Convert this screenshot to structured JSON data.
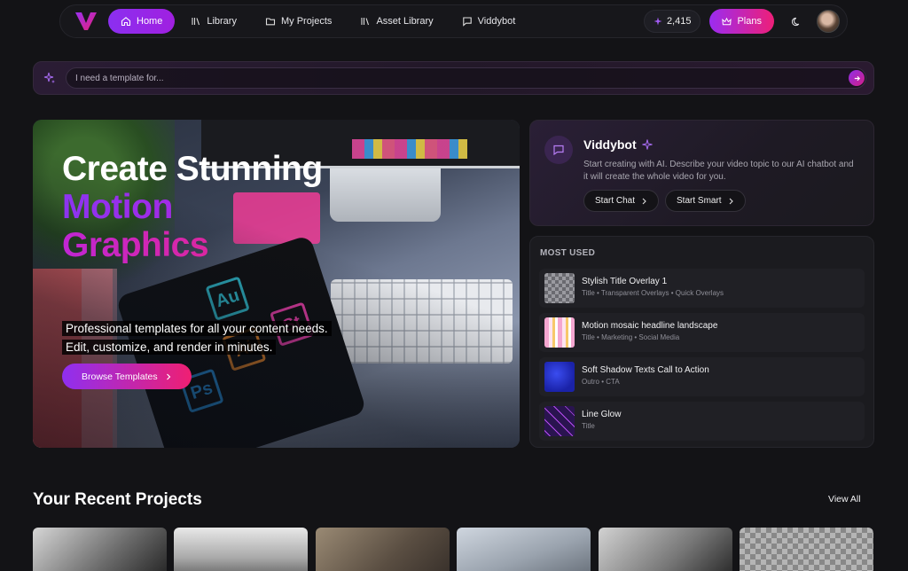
{
  "nav": {
    "items": [
      {
        "label": "Home",
        "icon": "home-icon",
        "active": true
      },
      {
        "label": "Library",
        "icon": "library-icon",
        "active": false
      },
      {
        "label": "My Projects",
        "icon": "folder-icon",
        "active": false
      },
      {
        "label": "Asset Library",
        "icon": "library-icon",
        "active": false
      },
      {
        "label": "Viddybot",
        "icon": "chat-icon",
        "active": false
      }
    ],
    "credits": "2,415",
    "plans_label": "Plans"
  },
  "prompt": {
    "placeholder": "I need a template for..."
  },
  "hero": {
    "title_line1": "Create Stunning",
    "title_line2": "Motion",
    "title_line3": "Graphics",
    "description": "Professional templates for all your content needs. Edit, customize, and render in minutes.",
    "browse_label": "Browse Templates",
    "app_icons": [
      "Au",
      "Ai",
      "St",
      "Ps"
    ]
  },
  "viddybot": {
    "title": "Viddybot",
    "description": "Start creating with AI. Describe your video topic to our AI chatbot and it will create the whole video for you.",
    "start_chat_label": "Start Chat",
    "start_smart_label": "Start Smart"
  },
  "most_used": {
    "heading": "MOST USED",
    "items": [
      {
        "name": "Stylish Title Overlay 1",
        "tags": "Title • Transparent Overlays • Quick Overlays"
      },
      {
        "name": "Motion mosaic headline landscape",
        "tags": "Title • Marketing • Social Media"
      },
      {
        "name": "Soft Shadow Texts Call to Action",
        "tags": "Outro • CTA"
      },
      {
        "name": "Line Glow",
        "tags": "Title"
      }
    ]
  },
  "recent": {
    "title": "Your Recent Projects",
    "view_all_label": "View All"
  },
  "colors": {
    "accent_purple": "#8b2ff0",
    "accent_pink": "#ef1f72",
    "background": "#131316"
  }
}
